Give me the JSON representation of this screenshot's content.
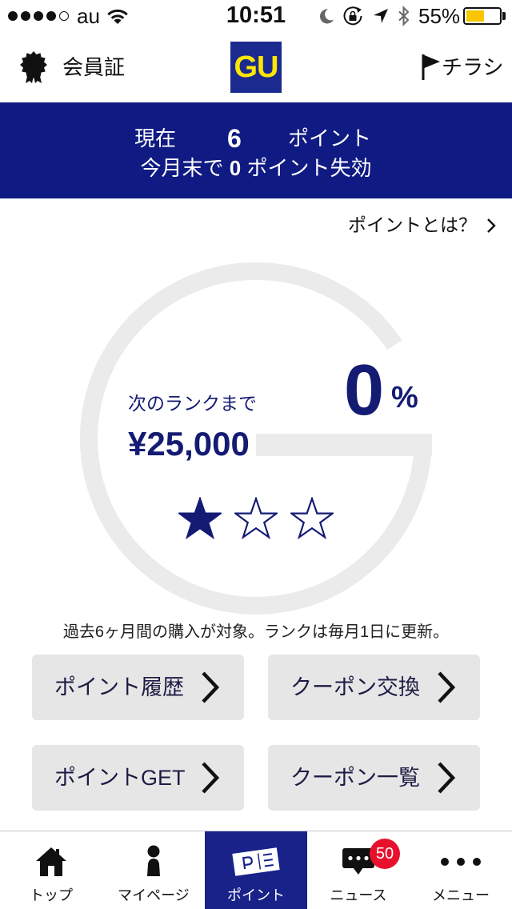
{
  "status_bar": {
    "signal_strength": 4,
    "signal_max": 5,
    "carrier": "au",
    "time": "10:51",
    "battery_text": "55%",
    "battery_level": 0.55
  },
  "header": {
    "member_card_label": "会員証",
    "member_card_icon": "badge-icon",
    "logo_text": "GU",
    "flyer_label": "チラシ",
    "flyer_icon": "flag-icon"
  },
  "points_banner": {
    "current_label": "現在",
    "current_points": "6",
    "points_unit": "ポイント",
    "expiry_prefix": "今月末で",
    "expiring_points": "0",
    "expiry_suffix": "ポイント失効"
  },
  "about_link": {
    "label": "ポイントとは？",
    "icon": "chevron-right-icon"
  },
  "rank": {
    "next_rank_label": "次のランクまで",
    "amount_to_next": "¥25,000",
    "progress_percent": "0",
    "percent_sign": "%",
    "stars_earned": 1,
    "stars_total": 3
  },
  "rank_note": "過去6ヶ月間の購入が対象。ランクは毎月1日に更新。",
  "actions": [
    {
      "label": "ポイント履歴",
      "icon": "chevron-right-icon"
    },
    {
      "label": "クーポン交換",
      "icon": "chevron-right-icon"
    },
    {
      "label": "ポイントGET",
      "icon": "chevron-right-icon"
    },
    {
      "label": "クーポン一覧",
      "icon": "chevron-right-icon"
    }
  ],
  "tab_bar": {
    "active_index": 2,
    "tabs": [
      {
        "label": "トップ",
        "icon": "home-icon"
      },
      {
        "label": "マイページ",
        "icon": "person-icon"
      },
      {
        "label": "ポイント",
        "icon": "point-card-icon"
      },
      {
        "label": "ニュース",
        "icon": "chat-bubble-icon",
        "badge": "50"
      },
      {
        "label": "メニュー",
        "icon": "more-dots-icon"
      }
    ]
  },
  "colors": {
    "brand_navy": "#0f1a82",
    "tab_active": "#182289",
    "logo_blue": "#1b2a8f",
    "logo_yellow": "#ffe600",
    "rank_text": "#141b73",
    "ring_gray": "#ebebeb",
    "button_bg": "#e6e6e6",
    "badge_red": "#e8112d",
    "battery_yellow": "#f7c600"
  }
}
